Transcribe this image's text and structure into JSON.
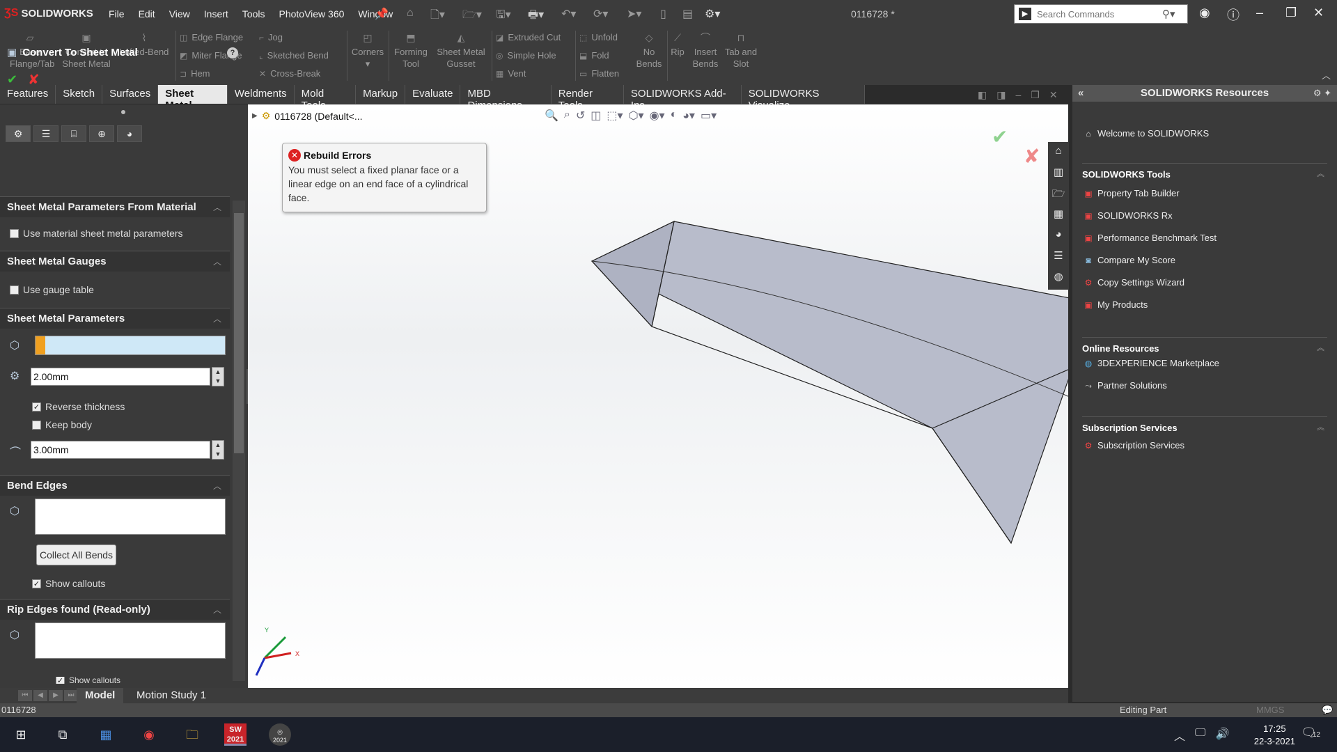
{
  "app": {
    "brand": "SOLIDWORKS",
    "document_title": "0116728 *",
    "menu": [
      "File",
      "Edit",
      "View",
      "Insert",
      "Tools",
      "PhotoView 360",
      "Window"
    ],
    "search_placeholder": "Search Commands"
  },
  "ribbon": {
    "big_buttons": [
      {
        "label1": "Base",
        "label2": "Flange/Tab"
      },
      {
        "label1": "Convert to",
        "label2": "Sheet Metal"
      },
      {
        "label1": "Lofted-Bend",
        "label2": ""
      }
    ],
    "group1": [
      "Edge Flange",
      "Miter Flange",
      "Hem"
    ],
    "group2": [
      "Jog",
      "Sketched Bend",
      "Cross-Break"
    ],
    "corners": "Corners",
    "forming": {
      "label1": "Forming",
      "label2": "Tool"
    },
    "gusset": {
      "label1": "Sheet Metal",
      "label2": "Gusset"
    },
    "group3": [
      "Extruded Cut",
      "Simple Hole",
      "Vent"
    ],
    "group4": [
      "Unfold",
      "Fold",
      "Flatten"
    ],
    "nobends": {
      "label1": "No",
      "label2": "Bends"
    },
    "rip": "Rip",
    "insertbends": {
      "label1": "Insert",
      "label2": "Bends"
    },
    "tabslot": {
      "label1": "Tab and",
      "label2": "Slot"
    }
  },
  "command_tabs": [
    "Features",
    "Sketch",
    "Surfaces",
    "Sheet Metal",
    "Weldments",
    "Mold Tools",
    "Markup",
    "Evaluate",
    "MBD Dimensions",
    "Render Tools",
    "SOLIDWORKS Add-Ins",
    "SOLIDWORKS Visualize"
  ],
  "active_tab": "Sheet Metal",
  "property_manager": {
    "title": "Convert To Sheet Metal",
    "sections": {
      "params_from_material": "Sheet Metal Parameters From Material",
      "use_material": "Use material sheet metal parameters",
      "gauges": "Sheet Metal Gauges",
      "use_gauge": "Use gauge table",
      "params": "Sheet Metal Parameters",
      "thickness": "2.00mm",
      "reverse_thickness": "Reverse thickness",
      "keep_body": "Keep body",
      "radius": "3.00mm",
      "bend_edges": "Bend Edges",
      "collect_all_bends": "Collect All Bends",
      "show_callouts": "Show callouts",
      "rip_edges": "Rip Edges found (Read-only)",
      "show_callouts2": "Show callouts"
    }
  },
  "viewport": {
    "tree_label": "0116728  (Default<...",
    "tooltip_title": "Rebuild Errors",
    "tooltip_message": "You must select a fixed planar face or a linear edge on an end face of a cylindrical face.",
    "axes": {
      "x": "X",
      "y": "Y"
    }
  },
  "resources": {
    "header": "SOLIDWORKS Resources",
    "welcome": "Welcome to SOLIDWORKS",
    "tools_title": "SOLIDWORKS Tools",
    "tools": [
      "Property Tab Builder",
      "SOLIDWORKS Rx",
      "Performance Benchmark Test",
      "Compare My Score",
      "Copy Settings Wizard",
      "My Products"
    ],
    "online_title": "Online Resources",
    "online": [
      "3DEXPERIENCE Marketplace",
      "Partner Solutions"
    ],
    "subs_title": "Subscription Services",
    "subs": [
      "Subscription Services"
    ]
  },
  "bottom_tabs": [
    "Model",
    "Motion Study 1"
  ],
  "status": {
    "left": "0116728",
    "center": "Editing Part",
    "right": "MMGS"
  },
  "taskbar": {
    "time": "17:25",
    "date": "22-3-2021",
    "notif": "12",
    "sw_badge": "2021"
  }
}
